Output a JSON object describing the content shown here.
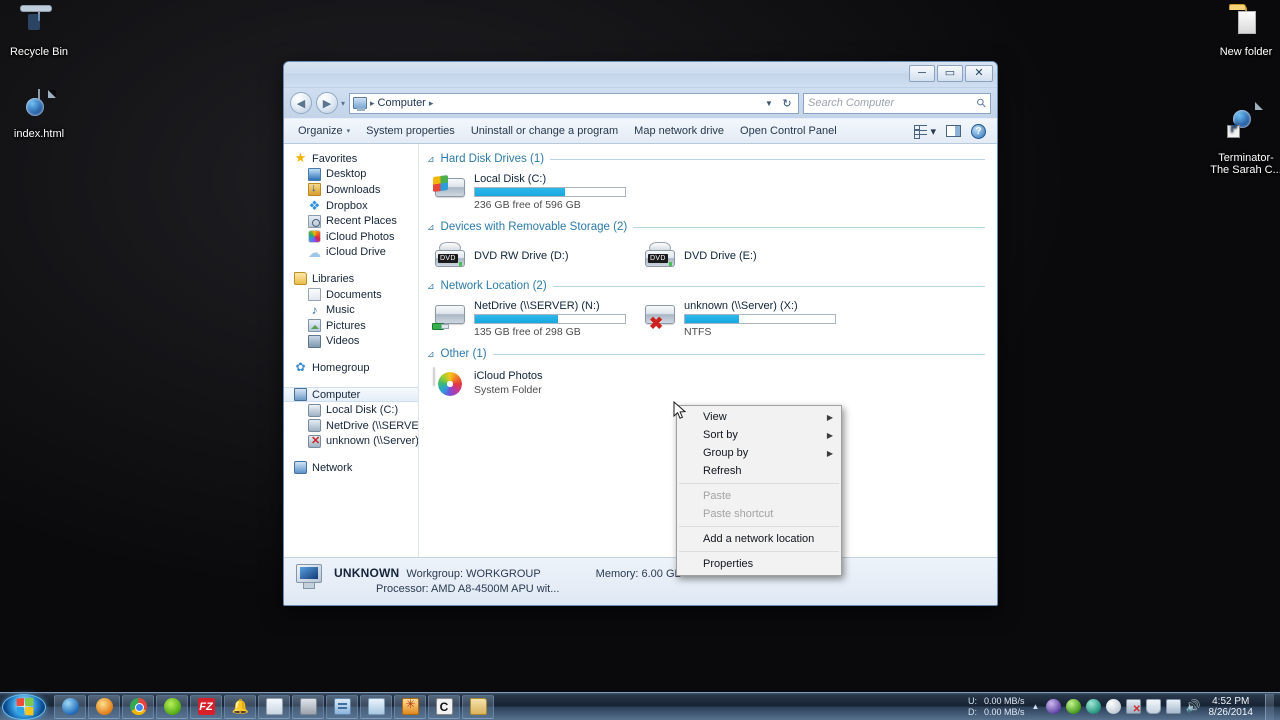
{
  "desktop": {
    "icons": [
      {
        "name": "Recycle Bin",
        "kind": "recycle-bin"
      },
      {
        "name": "index.html",
        "kind": "html-document"
      },
      {
        "name": "New folder",
        "kind": "folder"
      },
      {
        "name": "Terminator-\nThe Sarah C...",
        "kind": "html-document-shortcut"
      }
    ]
  },
  "window": {
    "titlebar": {
      "minimize_label": "─",
      "maximize_label": "▭",
      "close_label": "✕"
    },
    "address": {
      "computer_icon": "computer-icon",
      "crumb_root": "Computer",
      "sep": "▸",
      "dropdown": "▼",
      "refresh": "↻"
    },
    "search": {
      "placeholder": "Search Computer",
      "icon": "search-icon"
    },
    "commandbar": {
      "organize": "Organize",
      "organize_caret": "▾",
      "system_properties": "System properties",
      "uninstall": "Uninstall or change a program",
      "map_network_drive": "Map network drive",
      "open_control_panel": "Open Control Panel",
      "change_view_caret": "▾",
      "help_label": "?"
    },
    "navpane": {
      "groups": [
        {
          "header": {
            "label": "Favorites",
            "icon": "star-icon"
          },
          "items": [
            {
              "label": "Desktop",
              "icon": "desktop-icon"
            },
            {
              "label": "Downloads",
              "icon": "downloads-icon"
            },
            {
              "label": "Dropbox",
              "icon": "dropbox-icon"
            },
            {
              "label": "Recent Places",
              "icon": "recent-places-icon"
            },
            {
              "label": "iCloud Photos",
              "icon": "icloud-photos-icon"
            },
            {
              "label": "iCloud Drive",
              "icon": "icloud-drive-icon"
            }
          ]
        },
        {
          "header": {
            "label": "Libraries",
            "icon": "libraries-icon"
          },
          "items": [
            {
              "label": "Documents",
              "icon": "documents-icon"
            },
            {
              "label": "Music",
              "icon": "music-icon"
            },
            {
              "label": "Pictures",
              "icon": "pictures-icon"
            },
            {
              "label": "Videos",
              "icon": "videos-icon"
            }
          ]
        },
        {
          "header": {
            "label": "Homegroup",
            "icon": "homegroup-icon"
          },
          "items": []
        },
        {
          "header": {
            "label": "Computer",
            "icon": "computer-icon",
            "selected": true
          },
          "items": [
            {
              "label": "Local Disk (C:)",
              "icon": "local-disk-icon"
            },
            {
              "label": "NetDrive (\\\\SERVER) (",
              "icon": "network-drive-icon"
            },
            {
              "label": "unknown (\\\\Server) (",
              "icon": "network-drive-error-icon"
            }
          ]
        },
        {
          "header": {
            "label": "Network",
            "icon": "network-icon"
          },
          "items": []
        }
      ]
    },
    "content": {
      "groups": [
        {
          "title": "Hard Disk Drives (1)",
          "items": [
            {
              "name": "Local Disk (C:)",
              "sub": "236 GB free of 596 GB",
              "icon": "local-disk-icon",
              "bar_percent": 60,
              "has_bar": true
            }
          ]
        },
        {
          "title": "Devices with Removable Storage (2)",
          "items": [
            {
              "name": "DVD RW Drive (D:)",
              "sub": "",
              "icon": "dvd-rw-icon",
              "has_bar": false,
              "dvd_label": "DVD"
            },
            {
              "name": "DVD Drive (E:)",
              "sub": "",
              "icon": "dvd-icon",
              "has_bar": false,
              "dvd_label": "DVD"
            }
          ]
        },
        {
          "title": "Network Location (2)",
          "items": [
            {
              "name": "NetDrive (\\\\SERVER) (N:)",
              "sub": "135 GB free of 298 GB",
              "icon": "network-drive-icon",
              "bar_percent": 55,
              "has_bar": true
            },
            {
              "name": "unknown (\\\\Server) (X:)",
              "sub": "NTFS",
              "icon": "network-drive-error-icon",
              "bar_percent": 36,
              "has_bar": true
            }
          ]
        },
        {
          "title": "Other (1)",
          "items": [
            {
              "name": "iCloud Photos",
              "sub": "System Folder",
              "icon": "icloud-photos-icon",
              "has_bar": false
            }
          ]
        }
      ],
      "collapse_glyph": "⊿"
    },
    "statusbar": {
      "computer_name": "UNKNOWN",
      "workgroup": "Workgroup: WORKGROUP",
      "memory": "Memory: 6.00 GB",
      "processor": "Processor: AMD A8-4500M APU wit...",
      "icon": "computer-icon"
    }
  },
  "context_menu": {
    "items": [
      {
        "label": "View",
        "submenu": true,
        "disabled": false
      },
      {
        "label": "Sort by",
        "submenu": true,
        "disabled": false
      },
      {
        "label": "Group by",
        "submenu": true,
        "disabled": false
      },
      {
        "label": "Refresh",
        "submenu": false,
        "disabled": false
      },
      {
        "separator": true
      },
      {
        "label": "Paste",
        "submenu": false,
        "disabled": true
      },
      {
        "label": "Paste shortcut",
        "submenu": false,
        "disabled": true
      },
      {
        "separator": true
      },
      {
        "label": "Add a network location",
        "submenu": false,
        "disabled": false
      },
      {
        "separator": true
      },
      {
        "label": "Properties",
        "submenu": false,
        "disabled": false
      }
    ],
    "submenu_arrow": "▶"
  },
  "taskbar": {
    "start_label": "start-orb",
    "items": [
      {
        "icon": "internet-explorer-icon"
      },
      {
        "icon": "firefox-icon"
      },
      {
        "icon": "chrome-icon"
      },
      {
        "icon": "spotify-icon"
      },
      {
        "icon": "filezilla-icon",
        "label": "FZ"
      },
      {
        "icon": "bell-icon"
      },
      {
        "icon": "notepad-icon"
      },
      {
        "icon": "gray-app-icon"
      },
      {
        "icon": "window-app-icon"
      },
      {
        "icon": "blue-document-icon"
      },
      {
        "icon": "orange-app-icon"
      },
      {
        "icon": "c-app-icon",
        "label": "C"
      },
      {
        "icon": "explorer-folder-icon"
      }
    ],
    "tray": {
      "net_up_label": "U:",
      "net_down_label": "D:",
      "net_up_value": "0.00 MB/s",
      "net_down_value": "0.00 MB/s",
      "show_hidden": "▲",
      "icons": [
        {
          "icon": "purple-orb-icon"
        },
        {
          "icon": "green-orb-icon"
        },
        {
          "icon": "teal-orb-icon"
        },
        {
          "icon": "white-orb-icon"
        },
        {
          "icon": "network-error-icon"
        },
        {
          "icon": "shield-icon"
        },
        {
          "icon": "network-connection-icon"
        },
        {
          "icon": "volume-icon"
        }
      ],
      "time": "4:52 PM",
      "date": "8/26/2014"
    }
  }
}
